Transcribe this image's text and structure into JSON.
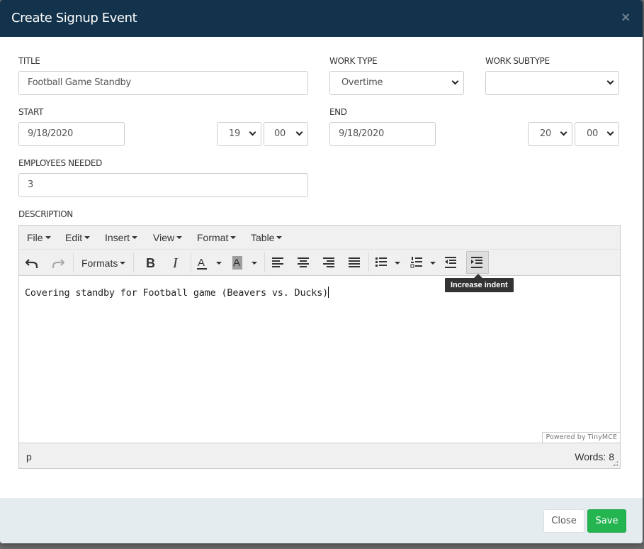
{
  "modal": {
    "title": "Create Signup Event",
    "close_glyph": "×"
  },
  "form": {
    "title_label": "TITLE",
    "title_value": "Football Game Standby",
    "work_type_label": "WORK TYPE",
    "work_type_value": "Overtime",
    "work_subtype_label": "WORK SUBTYPE",
    "work_subtype_value": "",
    "start_label": "START",
    "start_date": "9/18/2020",
    "start_hour": "19",
    "start_minute": "00",
    "end_label": "END",
    "end_date": "9/18/2020",
    "end_hour": "20",
    "end_minute": "00",
    "employees_label": "EMPLOYEES NEEDED",
    "employees_value": "3",
    "description_label": "DESCRIPTION"
  },
  "editor": {
    "menus": [
      "File",
      "Edit",
      "Insert",
      "View",
      "Format",
      "Table"
    ],
    "formats_label": "Formats",
    "content": "Covering standby for Football game (Beavers vs. Ducks)",
    "powered_by": "Powered by TinyMCE",
    "path": "p",
    "word_count": "Words: 8",
    "tooltip": "Increase indent",
    "icons": [
      "undo-icon",
      "redo-icon",
      "bold-icon",
      "italic-icon",
      "text-color-icon",
      "background-color-icon",
      "align-left-icon",
      "align-center-icon",
      "align-right-icon",
      "align-justify-icon",
      "bullet-list-icon",
      "numbered-list-icon",
      "outdent-icon",
      "indent-icon"
    ]
  },
  "footer": {
    "close_label": "Close",
    "save_label": "Save"
  },
  "colors": {
    "header_bg": "#13334c",
    "footer_bg": "#e5ecef",
    "save_green": "#24b550"
  }
}
